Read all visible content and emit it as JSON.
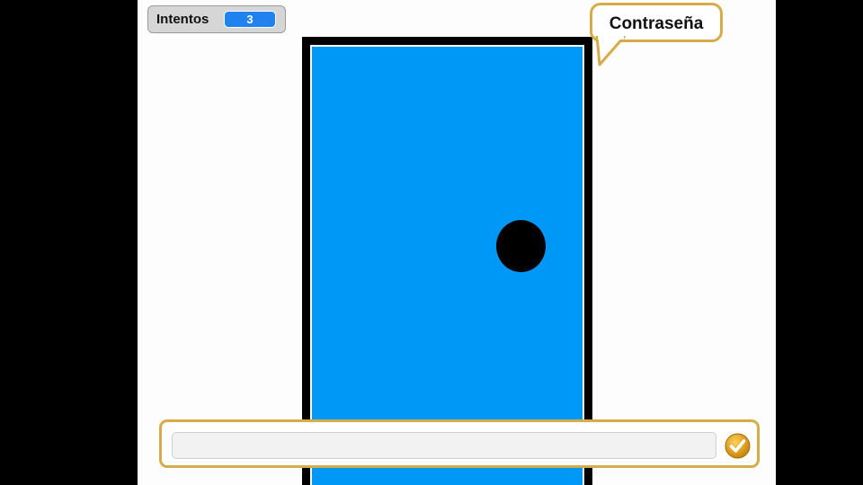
{
  "monitor": {
    "label": "Intentos",
    "value": "3",
    "value_color": "#1f82ee"
  },
  "bubble": {
    "text": "Contraseña"
  },
  "ask": {
    "input_value": "",
    "submit_icon": "checkmark-icon"
  },
  "colors": {
    "door": "#0098f7",
    "door_frame": "#000000",
    "knob": "#000000",
    "accent_border": "#d6ac48",
    "check_button": "#e0a015"
  }
}
